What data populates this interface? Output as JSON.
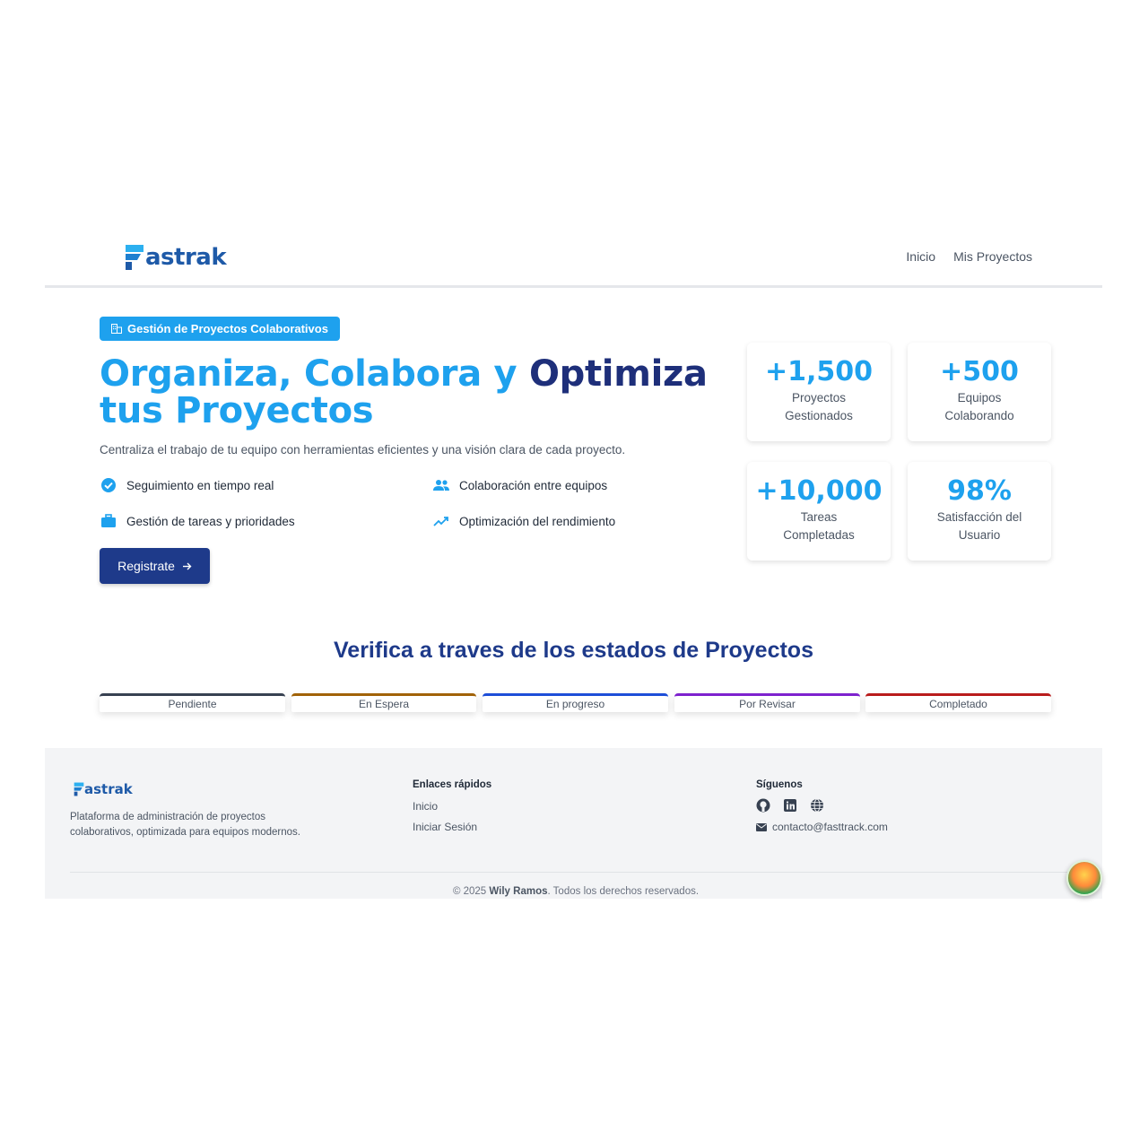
{
  "header": {
    "logo_text": "astrak",
    "nav": [
      "Inicio",
      "Mis Proyectos"
    ]
  },
  "hero": {
    "badge": "Gestión de Proyectos Colaborativos",
    "title_parts": [
      "Organiza, Colabora y ",
      "Optimiza",
      " tus Proyectos"
    ],
    "subtitle": "Centraliza el trabajo de tu equipo con herramientas eficientes y una visión clara de cada proyecto.",
    "features": [
      {
        "icon": "check-circle-icon",
        "label": "Seguimiento en tiempo real"
      },
      {
        "icon": "users-icon",
        "label": "Colaboración entre equipos"
      },
      {
        "icon": "briefcase-icon",
        "label": "Gestión de tareas y prioridades"
      },
      {
        "icon": "trending-up-icon",
        "label": "Optimización del rendimiento"
      }
    ],
    "cta_label": "Registrate"
  },
  "stats": [
    {
      "value": "+1,500",
      "label_lines": [
        "Proyectos",
        "Gestionados"
      ]
    },
    {
      "value": "+500",
      "label_lines": [
        "Equipos",
        "Colaborando"
      ]
    },
    {
      "value": "+10,000",
      "label_lines": [
        "Tareas",
        "Completadas"
      ]
    },
    {
      "value": "98%",
      "label_lines": [
        "Satisfacción del",
        "Usuario"
      ]
    }
  ],
  "status_section": {
    "title": "Verifica a traves de los estados de Proyectos",
    "statuses": [
      {
        "label": "Pendiente",
        "color": "#374151"
      },
      {
        "label": "En Espera",
        "color": "#a16207"
      },
      {
        "label": "En progreso",
        "color": "#1d4ed8"
      },
      {
        "label": "Por Revisar",
        "color": "#7e22ce"
      },
      {
        "label": "Completado",
        "color": "#b91c1c"
      }
    ]
  },
  "footer": {
    "logo_text": "astrak",
    "description": "Plataforma de administración de proyectos colaborativos, optimizada para equipos modernos.",
    "links_title": "Enlaces rápidos",
    "links": [
      "Inicio",
      "Iniciar Sesión"
    ],
    "social_title": "Síguenos",
    "social_icons": [
      "github-icon",
      "linkedin-icon",
      "globe-icon"
    ],
    "email": "contacto@fasttrack.com",
    "copyright_prefix": "© 2025 ",
    "copyright_name": "Wily Ramos",
    "copyright_suffix": ". Todos los derechos reservados."
  },
  "colors": {
    "accent": "#1ea1ee",
    "primary_dark": "#1e3a8a",
    "footer_bg": "#f3f4f6"
  }
}
